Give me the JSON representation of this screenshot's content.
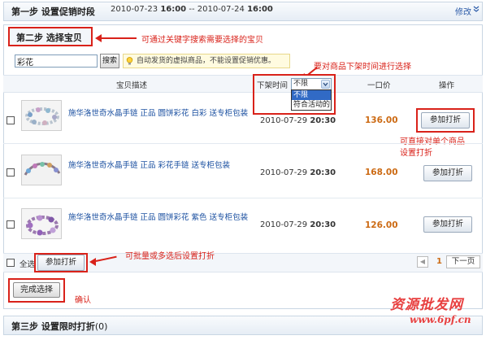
{
  "step1": {
    "title": "第一步 设置促销时段",
    "date_start": "2010-07-23",
    "time_start": "16:00",
    "separator": "--",
    "date_end": "2010-07-24",
    "time_end": "16:00",
    "edit_label": "修改"
  },
  "step2": {
    "title": "第二步 选择宝贝",
    "search_value": "彩花",
    "search_button": "搜索",
    "tip": "自动发货的虚拟商品，不能设置促销优惠。"
  },
  "annotations": {
    "search": "可通过关键字搜索需要选择的宝贝",
    "sort": "要对商品下架时间进行选择",
    "single": [
      "可直接对单个商品",
      "设置打折"
    ],
    "batch": "可批量或多选后设置打折",
    "confirm": "确认"
  },
  "table": {
    "columns": {
      "desc": "宝贝描述",
      "delist": "下架时间",
      "price": "一口价",
      "action": "操作"
    },
    "delist_select": {
      "selected": "不限",
      "options": [
        "不限",
        "符合活动的"
      ]
    },
    "rows": [
      {
        "title": "施华洛世奇水晶手链 正品 圆饼彩花 白彩 送专柜包装",
        "date": "2010-07-29",
        "time": "20:30",
        "price": "136.00",
        "action": "参加打折"
      },
      {
        "title": "施华洛世奇水晶手链 正品 彩花手链 送专柜包装",
        "date": "2010-07-29",
        "time": "20:30",
        "price": "168.00",
        "action": "参加打折"
      },
      {
        "title": "施华洛世奇水晶手链 正品 圆饼彩花 紫色 送专柜包装",
        "date": "2010-07-29",
        "time": "20:30",
        "price": "126.00",
        "action": "参加打折"
      }
    ]
  },
  "bottom": {
    "select_all": "全选",
    "batch_button": "参加打折",
    "page": "1",
    "next_label": "下一页"
  },
  "finish_button": "完成选择",
  "step3": {
    "title": "第三步 设置限时打折",
    "count": "(0)"
  },
  "watermark": {
    "text": "资源批发网",
    "url": "www.6pf.cn"
  }
}
